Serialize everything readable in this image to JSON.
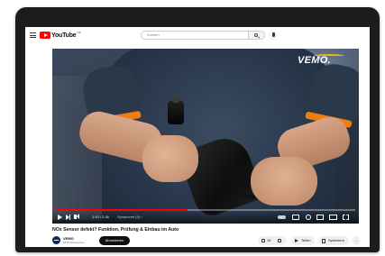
{
  "header": {
    "logo_text": "YouTube",
    "logo_country": "DE",
    "search_placeholder": "Suchen",
    "icons": [
      "menu-icon",
      "youtube-logo",
      "search-icon",
      "mic-icon"
    ]
  },
  "player": {
    "brand_logo": "VEMO.",
    "time": "1:10 / 2:36",
    "chapter": "Symptome (9) ›",
    "progress": 0.44,
    "progress_color": "#ff0000",
    "accent_orange": "#f07d12",
    "icons": [
      "play-icon",
      "next-icon",
      "volume-icon",
      "autoplay-icon",
      "cc-icon",
      "settings-icon",
      "miniplayer-icon",
      "theater-icon",
      "fullscreen-icon"
    ]
  },
  "video": {
    "title": "NOx Sensor defekt? Funktion, Prüfung & Einbau im Auto",
    "channel_name": "VEMO",
    "subscribers": "6676 Abonnenten",
    "subscribe_label": "Abonnieren",
    "like_count": "19",
    "share_label": "Teilen",
    "save_label": "Speichern",
    "more_label": "..."
  }
}
